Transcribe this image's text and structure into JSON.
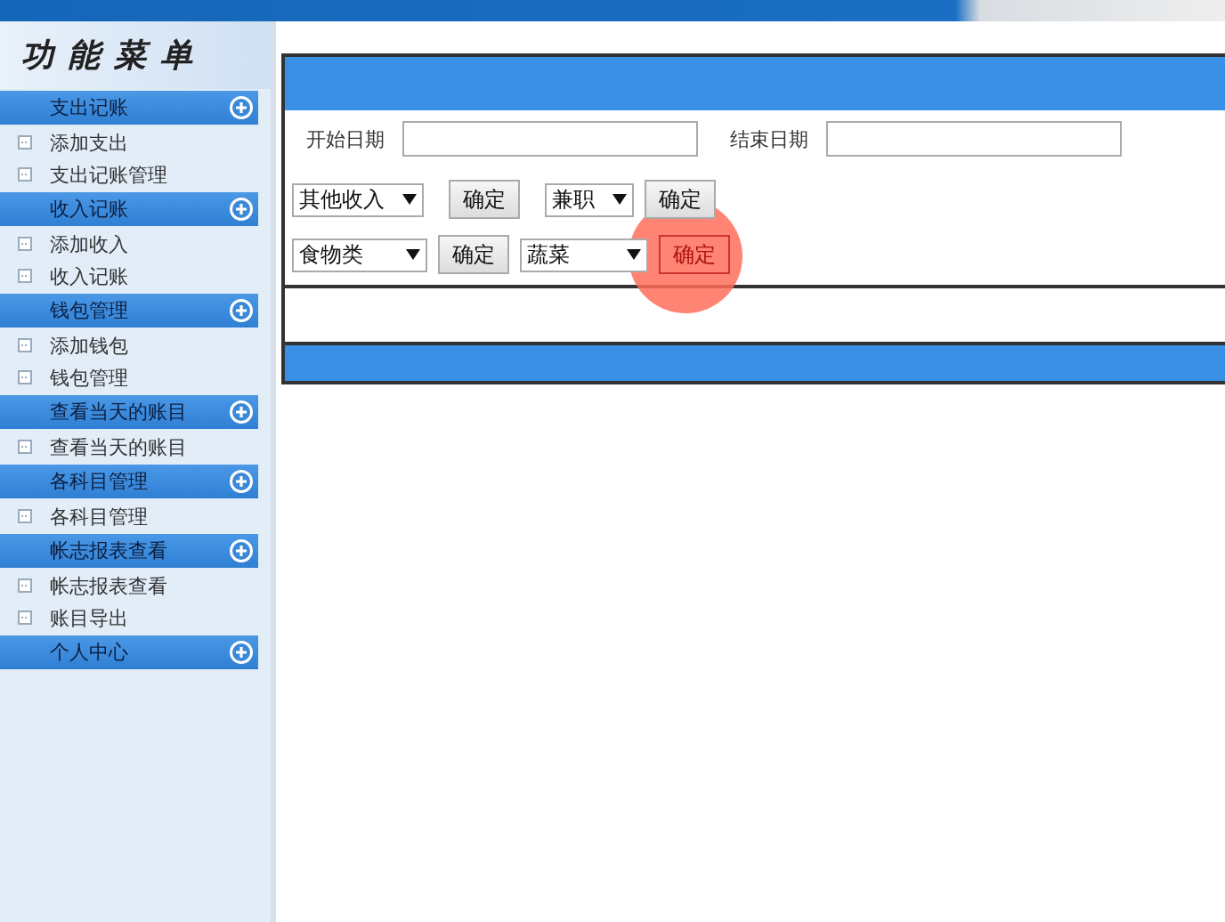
{
  "menu_title": "功能菜单",
  "menu": [
    {
      "label": "支出记账",
      "items": [
        "添加支出",
        "支出记账管理"
      ]
    },
    {
      "label": "收入记账",
      "items": [
        "添加收入",
        "收入记账"
      ]
    },
    {
      "label": "钱包管理",
      "items": [
        "添加钱包",
        "钱包管理"
      ]
    },
    {
      "label": "查看当天的账目",
      "items": [
        "查看当天的账目"
      ]
    },
    {
      "label": "各科目管理",
      "items": [
        "各科目管理"
      ]
    },
    {
      "label": "帐志报表查看",
      "items": [
        "帐志报表查看",
        "账目导出"
      ]
    },
    {
      "label": "个人中心"
    }
  ],
  "form": {
    "start_label": "开始日期",
    "end_label": "结束日期",
    "rows": [
      [
        {
          "kind": "select",
          "value": "其他收入"
        },
        {
          "kind": "button",
          "label": "确定",
          "clicked": false
        },
        {
          "kind": "select",
          "value": "兼职"
        },
        {
          "kind": "button",
          "label": "确定",
          "clicked": false
        }
      ],
      [
        {
          "kind": "select",
          "value": "食物类"
        },
        {
          "kind": "button",
          "label": "确定",
          "clicked": false
        },
        {
          "kind": "select",
          "value": "蔬菜"
        },
        {
          "kind": "button",
          "label": "确定",
          "clicked": true
        }
      ]
    ]
  }
}
